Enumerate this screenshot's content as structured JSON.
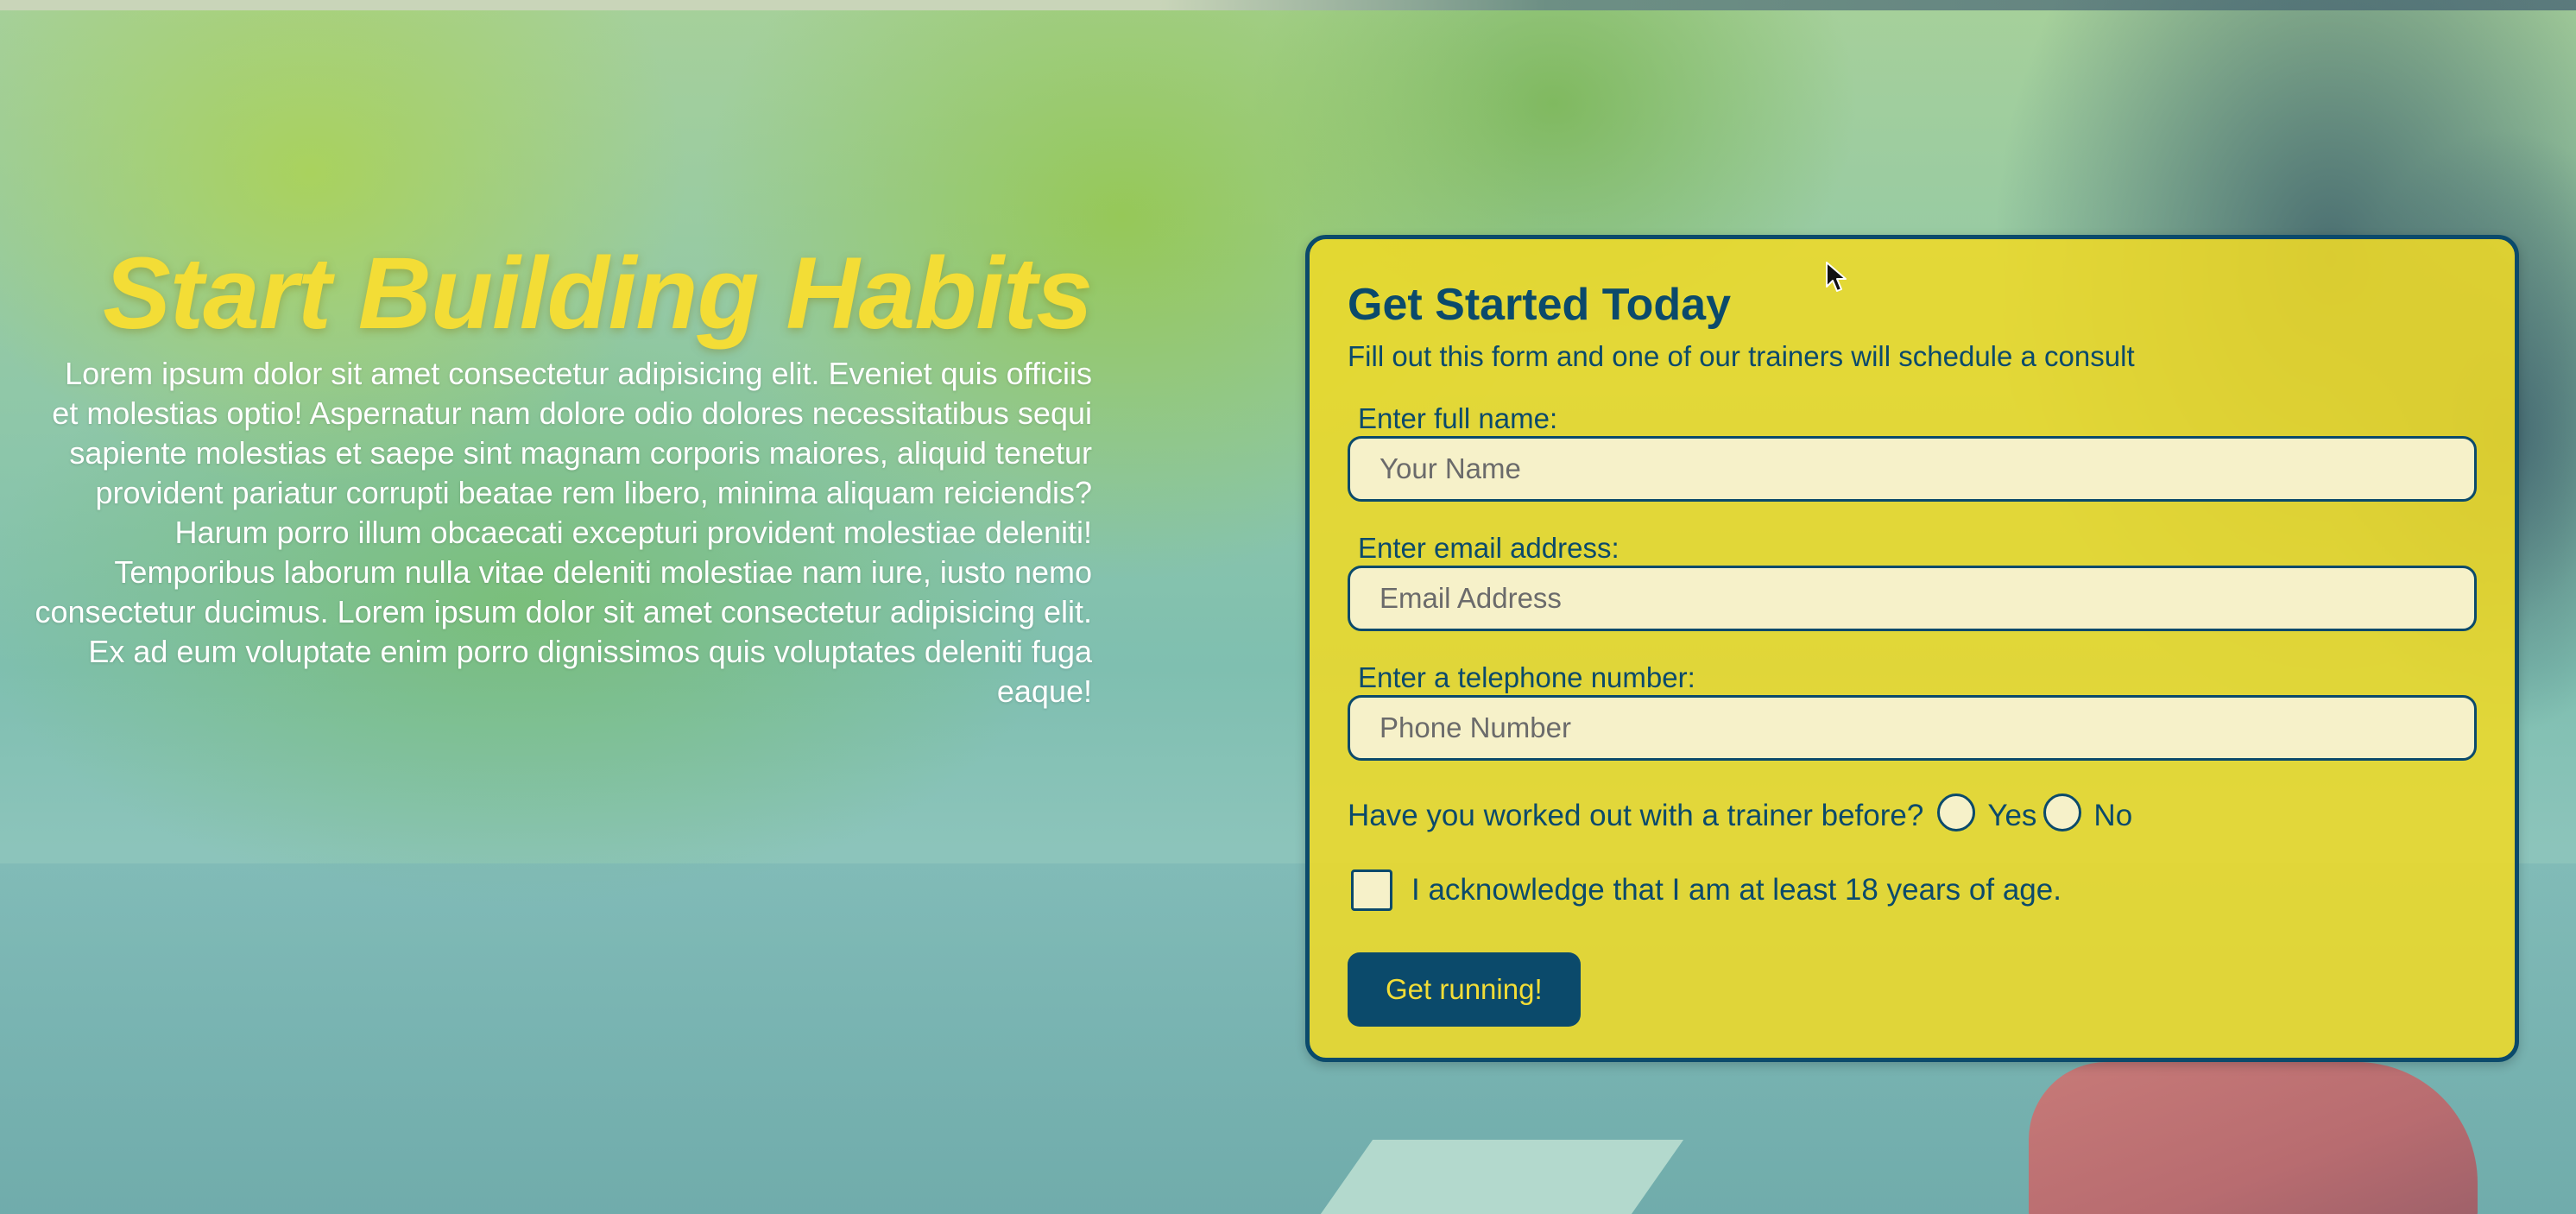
{
  "hero": {
    "title": "Start Building Habits",
    "body": "Lorem ipsum dolor sit amet consectetur adipisicing elit. Eveniet quis officiis et molestias optio! Aspernatur nam dolore odio dolores necessitatibus sequi sapiente molestias et saepe sint magnam corporis maiores, aliquid tenetur provident pariatur corrupti beatae rem libero, minima aliquam reiciendis? Harum porro illum obcaecati excepturi provident molestiae deleniti! Temporibus laborum nulla vitae deleniti molestiae nam iure, iusto nemo consectetur ducimus. Lorem ipsum dolor sit amet consectetur adipisicing elit. Ex ad eum voluptate enim porro dignissimos quis voluptates deleniti fuga eaque!"
  },
  "form": {
    "title": "Get Started Today",
    "subtitle": "Fill out this form and one of our trainers will schedule a consult",
    "name_label": "Enter full name:",
    "name_placeholder": "Your Name",
    "email_label": "Enter email address:",
    "email_placeholder": "Email Address",
    "phone_label": "Enter a telephone number:",
    "phone_placeholder": "Phone Number",
    "trainer_question": "Have you worked out with a trainer before?",
    "yes_label": "Yes",
    "no_label": "No",
    "age_ack": "I acknowledge that I am at least 18 years of age.",
    "submit_label": "Get running!"
  },
  "colors": {
    "accent_yellow": "#f3dd36",
    "navy": "#0b4a6b",
    "card_bg": "#eeda28",
    "input_bg": "#f6f1c9"
  }
}
